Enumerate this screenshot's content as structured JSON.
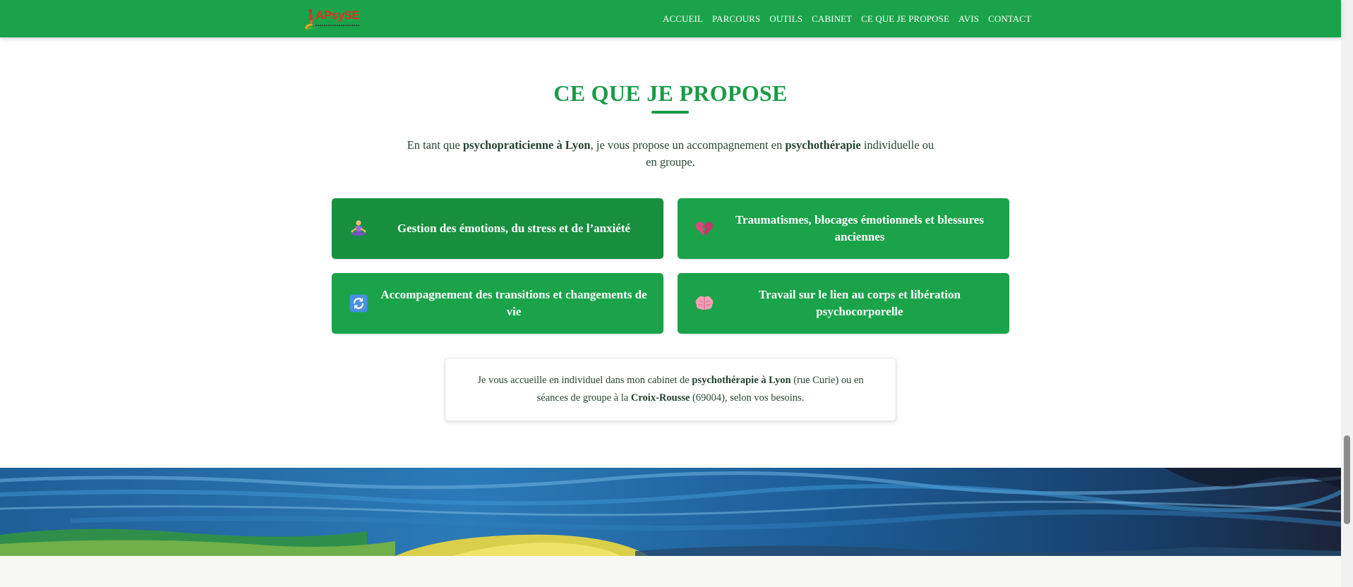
{
  "header": {
    "logo_text": "APsySE",
    "nav": [
      "ACCUEIL",
      "PARCOURS",
      "OUTILS",
      "CABINET",
      "CE QUE JE PROPOSE",
      "AVIS",
      "CONTACT"
    ]
  },
  "section": {
    "title": "CE QUE JE PROPOSE",
    "intro": {
      "p1": "En tant que ",
      "b1": "psychopraticienne à Lyon",
      "p2": ", je vous propose un accompagnement en ",
      "b2": "psychothérapie",
      "p3": " individuelle ou en groupe."
    },
    "cards": [
      {
        "icon": "meditation-icon",
        "label": "Gestion des émotions, du stress et de l’anxiété"
      },
      {
        "icon": "broken-heart-icon",
        "label": "Traumatismes, blocages émotionnels et blessures anciennes"
      },
      {
        "icon": "refresh-icon",
        "label": "Accompagnement des transitions et changements de vie"
      },
      {
        "icon": "brain-icon",
        "label": "Travail sur le lien au corps et libération psychocorporelle"
      }
    ],
    "info": {
      "p1": "Je vous accueille en individuel dans mon cabinet de ",
      "b1": "psychothérapie à Lyon",
      "p2": " (rue Curie) ou en séances de groupe à la ",
      "b2": "Croix-Rousse",
      "p3": " (69004), selon vos besoins."
    }
  },
  "colors": {
    "primary_green": "#1aa34a",
    "active_card_green": "#178f3f",
    "title_green": "#1a9a48",
    "logo_red": "#d7361f"
  }
}
